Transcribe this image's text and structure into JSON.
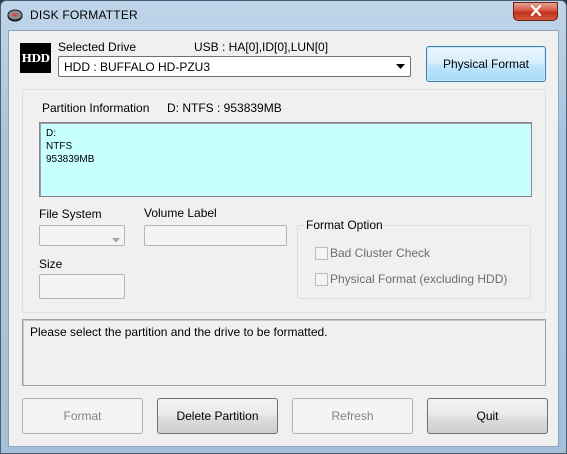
{
  "window": {
    "title": "DISK FORMATTER"
  },
  "icons": {
    "app": "disk-icon",
    "close": "close-icon",
    "dropdown": "chevron-down-icon",
    "hdd": "hdd-logo"
  },
  "hdd_logo_text": "HDD",
  "drive": {
    "label": "Selected Drive",
    "usb_info": "USB : HA[0],ID[0],LUN[0]",
    "selected": "HDD : BUFFALO HD-PZU3"
  },
  "buttons": {
    "physical_format": "Physical Format",
    "format": "Format",
    "delete_partition": "Delete Partition",
    "refresh": "Refresh",
    "quit": "Quit"
  },
  "partition": {
    "label": "Partition Information",
    "summary": "D: NTFS : 953839MB",
    "lines": [
      "D:",
      "NTFS",
      "953839MB"
    ]
  },
  "fields": {
    "file_system_label": "File System",
    "volume_label_label": "Volume Label",
    "size_label": "Size"
  },
  "format_option": {
    "title": "Format Option",
    "bad_cluster": "Bad Cluster Check",
    "physical_excl": "Physical Format (excluding HDD)"
  },
  "status": "Please select the partition and the drive to be formatted."
}
